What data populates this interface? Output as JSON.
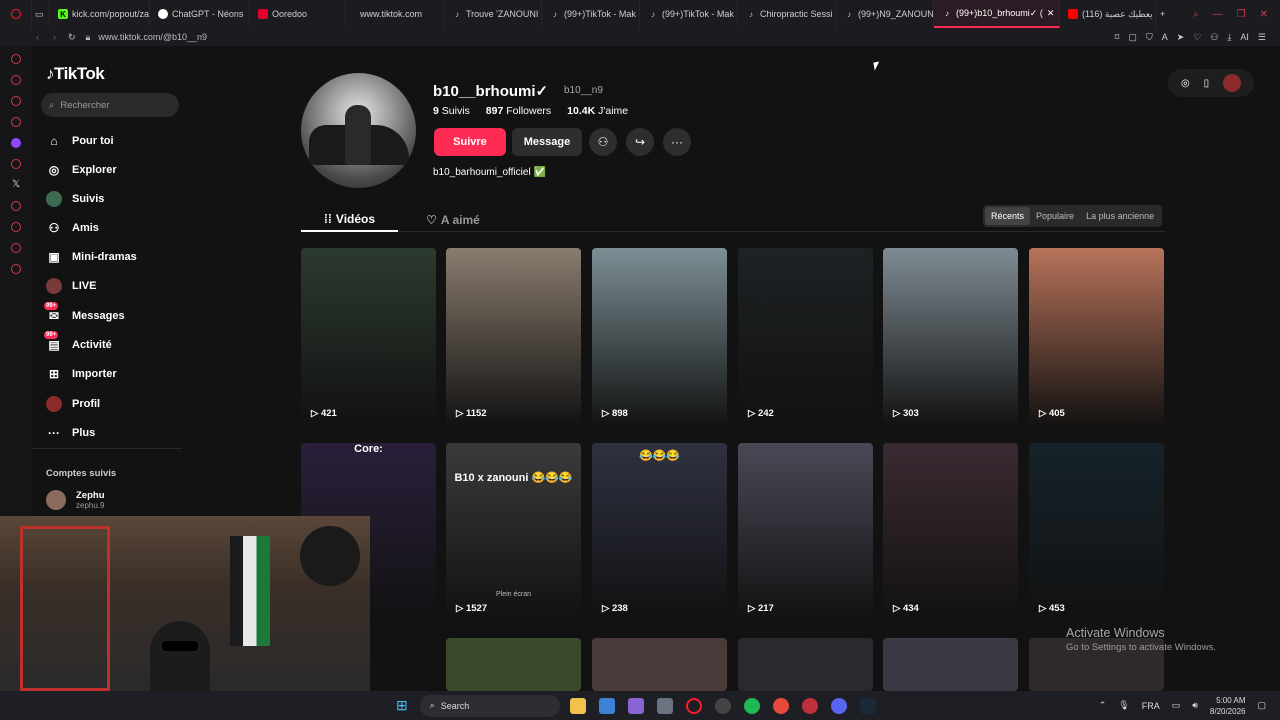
{
  "browser": {
    "tabs": [
      {
        "title": "kick.com/popout/za",
        "color": "#53fc18"
      },
      {
        "title": "ChatGPT - Néons",
        "color": "#ffffff"
      },
      {
        "title": "Ooredoo",
        "color": "#e4002b"
      },
      {
        "title": "www.tiktok.com",
        "color": "#ffffff"
      },
      {
        "title": "Trouve 'ZANOUNI",
        "color": "#ffffff"
      },
      {
        "title": "(99+)TikTok - Mak",
        "color": "#ffffff"
      },
      {
        "title": "(99+)TikTok - Mak",
        "color": "#ffffff"
      },
      {
        "title": "Chiropractic Sessi",
        "color": "#ffffff"
      },
      {
        "title": "(99+)N9_ZANOUN",
        "color": "#ffffff"
      },
      {
        "title": "(99+)b10_brhoumi✓ (",
        "color": "#ffffff"
      },
      {
        "title": "يعطيك عصبة (116)",
        "color": "#ff0000"
      }
    ],
    "url": "www.tiktok.com/@b10__n9"
  },
  "sidebar": {
    "logo": "TikTok",
    "search_placeholder": "Rechercher",
    "items": [
      {
        "label": "Pour toi",
        "icon": "home-icon"
      },
      {
        "label": "Explorer",
        "icon": "compass-icon"
      },
      {
        "label": "Suivis",
        "icon": "following-avatar-icon"
      },
      {
        "label": "Amis",
        "icon": "friends-icon"
      },
      {
        "label": "Mini-dramas",
        "icon": "film-icon"
      },
      {
        "label": "LIVE",
        "icon": "live-icon"
      },
      {
        "label": "Messages",
        "icon": "message-icon",
        "badge": "99+"
      },
      {
        "label": "Activité",
        "icon": "activity-icon",
        "badge": "99+"
      },
      {
        "label": "Importer",
        "icon": "upload-icon"
      },
      {
        "label": "Profil",
        "icon": "profile-icon"
      },
      {
        "label": "Plus",
        "icon": "more-icon"
      }
    ],
    "following_title": "Comptes suivis",
    "following": [
      {
        "name": "Zephu",
        "handle": "zephu.9"
      }
    ]
  },
  "profile": {
    "display_name": "b10__brhoumi✓",
    "username": "b10__n9",
    "following_count": "9",
    "following_label": "Suivis",
    "followers_count": "897",
    "followers_label": "Followers",
    "likes_count": "10.4K",
    "likes_label": "J'aime",
    "follow_button": "Suivre",
    "message_button": "Message",
    "bio": "b10_barhoumi_officiel ✅",
    "tab_videos": "Vidéos",
    "tab_liked": "A aimé",
    "sort_options": [
      "Récents",
      "Populaire",
      "La plus ancienne"
    ],
    "sort_selected": "Récents"
  },
  "videos": [
    {
      "views": "421",
      "caption": "",
      "bg": "#2c3a2f"
    },
    {
      "views": "1152",
      "caption": "",
      "bg": "#8a7c6e"
    },
    {
      "views": "898",
      "caption": "",
      "bg": "#7c8f95"
    },
    {
      "views": "242",
      "caption": "",
      "bg": "#1e2224"
    },
    {
      "views": "303",
      "caption": "",
      "bg": "#7f8b93"
    },
    {
      "views": "405",
      "caption": "",
      "bg": "#b8735a"
    },
    {
      "views": "",
      "caption": "Core:",
      "bg": "#2a1f3a"
    },
    {
      "views": "1527",
      "caption": "B10 x zanouni 😂😂😂",
      "bg": "#3a3a3a"
    },
    {
      "views": "238",
      "caption": "😂😂😂",
      "bg": "#2f3142"
    },
    {
      "views": "217",
      "caption": "",
      "bg": "#4b4856"
    },
    {
      "views": "434",
      "caption": "",
      "bg": "#3b2a33"
    },
    {
      "views": "453",
      "caption": "",
      "bg": "#16222a"
    }
  ],
  "video_overlay": {
    "plein_ecran": "Plein écran"
  },
  "windows_watermark": {
    "title": "Activate Windows",
    "sub": "Go to Settings to activate Windows."
  },
  "taskbar": {
    "search": "Search",
    "lang": "FRA",
    "time": "5:00 AM",
    "date": "8/20/2026"
  }
}
